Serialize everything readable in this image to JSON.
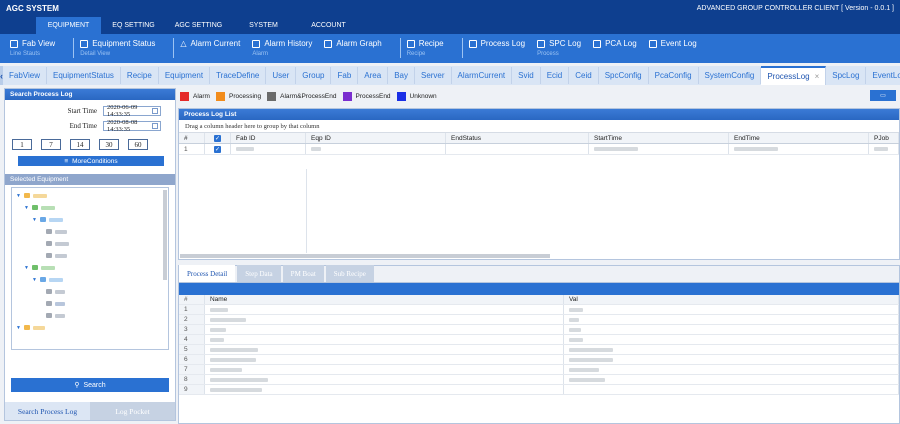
{
  "title_bar": {
    "app_name": "AGC SYSTEM",
    "version": "ADVANCED GROUP CONTROLLER CLIENT [ Version - 0.0.1 ]"
  },
  "menu": [
    "EQUIPMENT",
    "EQ SETTING",
    "AGC SETTING",
    "SYSTEM",
    "ACCOUNT"
  ],
  "toolbar": [
    {
      "label": "Fab View",
      "sub": "Line Stauts",
      "icon": "fab-view-icon"
    },
    {
      "label": "Equipment Status",
      "sub": "Detail View",
      "icon": "equipment-status-icon"
    },
    {
      "label": "Alarm Current",
      "sub": "",
      "icon": "warning-icon"
    },
    {
      "label": "Alarm History",
      "sub": "Alarm",
      "icon": "calendar-icon"
    },
    {
      "label": "Alarm Graph",
      "sub": "",
      "icon": "graph-icon"
    },
    {
      "label": "Recipe",
      "sub": "Recipe",
      "icon": "recipe-icon"
    },
    {
      "label": "Process Log",
      "sub": "",
      "icon": "log-icon"
    },
    {
      "label": "SPC Log",
      "sub": "Process",
      "icon": "spc-icon"
    },
    {
      "label": "PCA Log",
      "sub": "",
      "icon": "pca-icon"
    },
    {
      "label": "Event Log",
      "sub": "",
      "icon": "event-icon"
    }
  ],
  "tabs": [
    "FabView",
    "EquipmentStatus",
    "Recipe",
    "Equipment",
    "TraceDefine",
    "User",
    "Group",
    "Fab",
    "Area",
    "Bay",
    "Server",
    "AlarmCurrent",
    "Svid",
    "Ecid",
    "Ceid",
    "SpcConfig",
    "PcaConfig",
    "SystemConfig",
    "ProcessLog",
    "SpcLog",
    "EventLog"
  ],
  "active_tab": "ProcessLog",
  "search_panel": {
    "title": "Search Process Log",
    "start_label": "Start Time",
    "start_value": "2020-06-09 14:33:35",
    "end_label": "End Time",
    "end_value": "2020-08-08 14:33:35",
    "day_buttons": [
      "1",
      "7",
      "14",
      "30",
      "60"
    ],
    "more_conditions": "MoreConditions",
    "selected_equipment": "Selected Equipment",
    "search": "Search",
    "tab_search": "Search Process Log",
    "tab_pocket": "Log Pocket"
  },
  "legend": [
    {
      "label": "Alarm",
      "color": "#e52a2a"
    },
    {
      "label": "Processing",
      "color": "#f28c1c"
    },
    {
      "label": "Alarm&ProcessEnd",
      "color": "#6b6b6b"
    },
    {
      "label": "ProcessEnd",
      "color": "#7a2ecf"
    },
    {
      "label": "Unknown",
      "color": "#1a2fe6"
    }
  ],
  "process_log": {
    "title": "Process Log List",
    "group_hint": "Drag a column header here to group by that column",
    "columns": [
      "#",
      "",
      "Fab ID",
      "Eqp ID",
      "EndStatus",
      "StartTime",
      "EndTime",
      "PJob"
    ],
    "rows": [
      {
        "num": "1"
      }
    ]
  },
  "detail": {
    "tabs": [
      "Process Detail",
      "Step Data",
      "PM Boat",
      "Sub Recipe"
    ],
    "columns": [
      "#",
      "Name",
      "Val"
    ],
    "row_numbers": [
      "1",
      "2",
      "3",
      "4",
      "5",
      "6",
      "7",
      "8",
      "9"
    ]
  }
}
